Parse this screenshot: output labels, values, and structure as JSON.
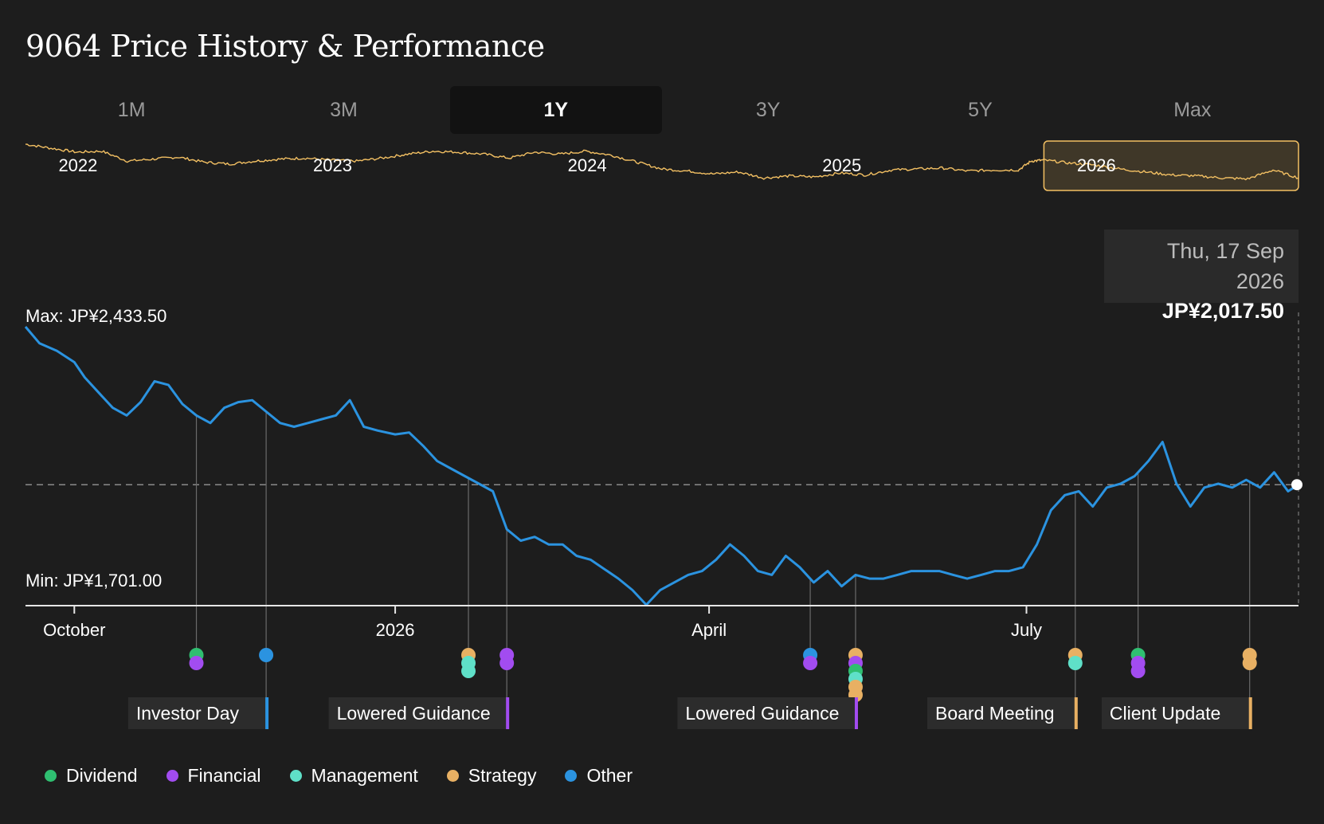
{
  "title": "9064 Price History & Performance",
  "tabs": [
    {
      "label": "1M",
      "active": false
    },
    {
      "label": "3M",
      "active": false
    },
    {
      "label": "1Y",
      "active": true
    },
    {
      "label": "3Y",
      "active": false
    },
    {
      "label": "5Y",
      "active": false
    },
    {
      "label": "Max",
      "active": false
    }
  ],
  "tooltip": {
    "date": "Thu, 17 Sep 2026",
    "price": "JP¥2,017.50"
  },
  "colors": {
    "background": "#1d1d1d",
    "main_line": "#2b93e0",
    "overview_line": "#f3c063",
    "Dividend": "#2fbf71",
    "Financial": "#a24cf0",
    "Management": "#5fe0c8",
    "Strategy": "#e8b063",
    "Other": "#2b93e0"
  },
  "chart_data": {
    "type": "line",
    "currency": "JP¥",
    "overview": {
      "year_labels": [
        "2022",
        "2023",
        "2024",
        "2025",
        "2026"
      ],
      "year_label_positions": [
        2022.0,
        2023.0,
        2024.0,
        2025.0,
        2026.0
      ],
      "x_range": [
        2021.8,
        2026.8
      ],
      "selected_range": [
        2025.8,
        2026.8
      ],
      "x": [
        2021.8,
        2021.9,
        2022.0,
        2022.1,
        2022.2,
        2022.3,
        2022.4,
        2022.5,
        2022.6,
        2022.7,
        2022.8,
        2022.9,
        2023.0,
        2023.1,
        2023.2,
        2023.3,
        2023.4,
        2023.5,
        2023.6,
        2023.7,
        2023.8,
        2023.9,
        2024.0,
        2024.1,
        2024.2,
        2024.3,
        2024.4,
        2024.5,
        2024.6,
        2024.7,
        2024.8,
        2024.9,
        2025.0,
        2025.1,
        2025.2,
        2025.3,
        2025.4,
        2025.5,
        2025.6,
        2025.7,
        2025.75,
        2025.8,
        2025.9,
        2026.0,
        2026.1,
        2026.2,
        2026.3,
        2026.4,
        2026.5,
        2026.6,
        2026.7,
        2026.8
      ],
      "y": [
        2510,
        2470,
        2430,
        2440,
        2340,
        2360,
        2380,
        2330,
        2310,
        2340,
        2360,
        2370,
        2350,
        2340,
        2370,
        2410,
        2440,
        2430,
        2410,
        2370,
        2430,
        2410,
        2440,
        2400,
        2330,
        2260,
        2240,
        2210,
        2230,
        2170,
        2190,
        2180,
        2220,
        2200,
        2250,
        2260,
        2270,
        2240,
        2250,
        2250,
        2340,
        2350,
        2320,
        2300,
        2260,
        2230,
        2200,
        2190,
        2170,
        2160,
        2250,
        2170
      ]
    },
    "main": {
      "x_range": [
        "2025-09-17",
        "2026-09-17"
      ],
      "y_range": [
        1701.0,
        2433.5
      ],
      "x_ticks": [
        {
          "label": "October",
          "date": "2025-10-01"
        },
        {
          "label": "2026",
          "date": "2026-01-01"
        },
        {
          "label": "April",
          "date": "2026-04-01"
        },
        {
          "label": "July",
          "date": "2026-07-01"
        }
      ],
      "max_label": "Max: JP¥2,433.50",
      "min_label": "Min: JP¥1,701.00",
      "reference_price": 2017.5,
      "series": [
        {
          "dates": [
            "2025-09-17",
            "2025-09-21",
            "2025-09-26",
            "2025-10-01",
            "2025-10-04",
            "2025-10-08",
            "2025-10-12",
            "2025-10-16",
            "2025-10-20",
            "2025-10-24",
            "2025-10-28",
            "2025-11-01",
            "2025-11-05",
            "2025-11-09",
            "2025-11-13",
            "2025-11-17",
            "2025-11-21",
            "2025-11-25",
            "2025-11-29",
            "2025-12-03",
            "2025-12-07",
            "2025-12-11",
            "2025-12-15",
            "2025-12-19",
            "2025-12-23",
            "2025-12-27",
            "2026-01-01",
            "2026-01-05",
            "2026-01-09",
            "2026-01-13",
            "2026-01-17",
            "2026-01-21",
            "2026-01-25",
            "2026-01-29",
            "2026-02-02",
            "2026-02-06",
            "2026-02-10",
            "2026-02-14",
            "2026-02-18",
            "2026-02-22",
            "2026-02-26",
            "2026-03-02",
            "2026-03-06",
            "2026-03-10",
            "2026-03-14",
            "2026-03-18",
            "2026-03-22",
            "2026-03-26",
            "2026-03-30",
            "2026-04-03",
            "2026-04-07",
            "2026-04-11",
            "2026-04-15",
            "2026-04-19",
            "2026-04-23",
            "2026-04-27",
            "2026-05-01",
            "2026-05-05",
            "2026-05-09",
            "2026-05-13",
            "2026-05-17",
            "2026-05-21",
            "2026-05-25",
            "2026-05-29",
            "2026-06-02",
            "2026-06-06",
            "2026-06-10",
            "2026-06-14",
            "2026-06-18",
            "2026-06-22",
            "2026-06-26",
            "2026-06-30",
            "2026-07-04",
            "2026-07-08",
            "2026-07-12",
            "2026-07-16",
            "2026-07-20",
            "2026-07-24",
            "2026-07-28",
            "2026-08-01",
            "2026-08-05",
            "2026-08-09",
            "2026-08-13",
            "2026-08-17",
            "2026-08-21",
            "2026-08-25",
            "2026-08-29",
            "2026-09-02",
            "2026-09-06",
            "2026-09-10",
            "2026-09-14",
            "2026-09-17"
          ],
          "values": [
            2433.5,
            2390,
            2370,
            2340,
            2300,
            2260,
            2220,
            2200,
            2235,
            2290,
            2280,
            2230,
            2200,
            2180,
            2220,
            2235,
            2240,
            2210,
            2180,
            2170,
            2180,
            2190,
            2200,
            2240,
            2170,
            2160,
            2150,
            2155,
            2120,
            2080,
            2060,
            2040,
            2020,
            2000,
            1900,
            1870,
            1880,
            1860,
            1860,
            1830,
            1820,
            1795,
            1770,
            1740,
            1701,
            1740,
            1760,
            1780,
            1790,
            1820,
            1860,
            1830,
            1790,
            1780,
            1830,
            1800,
            1760,
            1790,
            1750,
            1780,
            1770,
            1770,
            1780,
            1790,
            1790,
            1790,
            1780,
            1770,
            1780,
            1790,
            1790,
            1800,
            1860,
            1950,
            1990,
            2000,
            1960,
            2010,
            2020,
            2040,
            2080,
            2130,
            2020,
            1960,
            2010,
            2020,
            2010,
            2030,
            2010,
            2050,
            2000,
            2017.5
          ]
        }
      ],
      "events": [
        {
          "date": "2025-11-05",
          "categories": [
            "Dividend",
            "Financial"
          ],
          "callout": ""
        },
        {
          "date": "2025-11-25",
          "categories": [
            "Other"
          ],
          "callout": "Investor Day",
          "callout_category": "Other"
        },
        {
          "date": "2026-01-22",
          "categories": [
            "Strategy",
            "Management",
            "Management"
          ],
          "callout": ""
        },
        {
          "date": "2026-02-02",
          "categories": [
            "Financial",
            "Financial"
          ],
          "callout": "Lowered Guidance",
          "callout_category": "Financial"
        },
        {
          "date": "2026-04-30",
          "categories": [
            "Other",
            "Financial"
          ],
          "callout": ""
        },
        {
          "date": "2026-05-13",
          "categories": [
            "Strategy",
            "Financial",
            "Dividend",
            "Management",
            "Strategy",
            "Strategy"
          ],
          "callout": "Lowered Guidance",
          "callout_category": "Financial"
        },
        {
          "date": "2026-07-15",
          "categories": [
            "Strategy",
            "Management"
          ],
          "callout": "Board Meeting",
          "callout_category": "Strategy"
        },
        {
          "date": "2026-08-02",
          "categories": [
            "Dividend",
            "Financial",
            "Financial"
          ],
          "callout": ""
        },
        {
          "date": "2026-09-03",
          "categories": [
            "Strategy",
            "Strategy"
          ],
          "callout": "Client Update",
          "callout_category": "Strategy"
        }
      ]
    },
    "legend": [
      "Dividend",
      "Financial",
      "Management",
      "Strategy",
      "Other"
    ]
  }
}
